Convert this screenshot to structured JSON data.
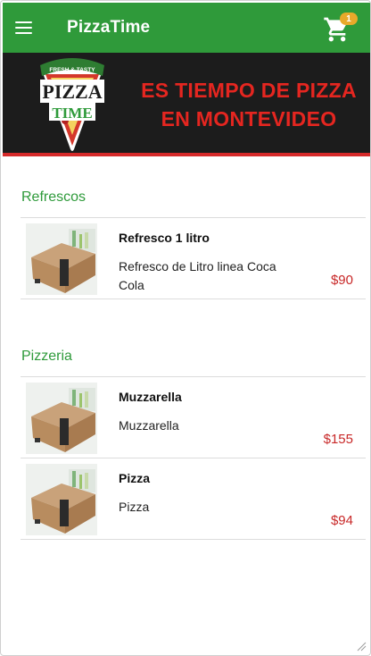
{
  "app": {
    "title": "PizzaTime"
  },
  "cart": {
    "count": "1"
  },
  "banner": {
    "logo_top_text": "FRESH & TASTY",
    "logo_word1": "PIZZA",
    "logo_word2": "TIME",
    "headline_line1": "ES TIEMPO DE PIZZA",
    "headline_line2": "EN MONTEVIDEO"
  },
  "sections": [
    {
      "title": "Refrescos",
      "items": [
        {
          "name": "Refresco 1 litro",
          "description": "Refresco de Litro linea Coca Cola",
          "price": "$90"
        }
      ]
    },
    {
      "title": "Pizzeria",
      "items": [
        {
          "name": "Muzzarella",
          "description": "Muzzarella",
          "price": "$155"
        },
        {
          "name": "Pizza",
          "description": "Pizza",
          "price": "$94"
        }
      ]
    }
  ],
  "colors": {
    "primary": "#2f9a3a",
    "price": "#c82828",
    "banner_bg": "#1c1c1c",
    "banner_text": "#e52620",
    "badge": "#e8a92a"
  },
  "icons": {
    "menu": "hamburger-menu-icon",
    "cart": "shopping-cart-icon"
  }
}
